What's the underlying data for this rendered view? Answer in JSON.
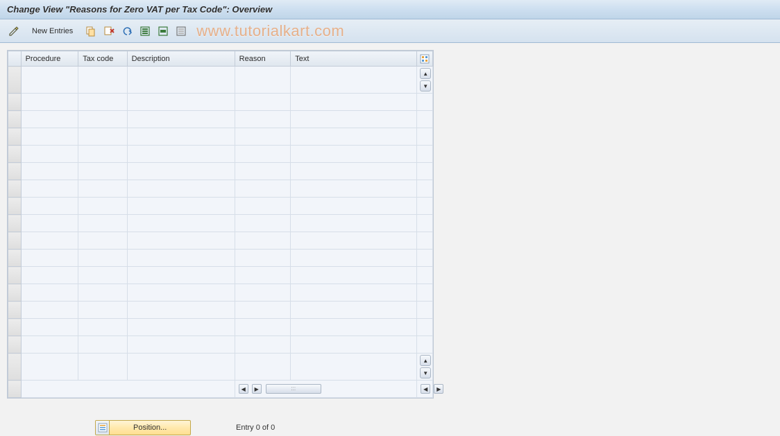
{
  "title": "Change View \"Reasons for Zero VAT per Tax Code\": Overview",
  "toolbar": {
    "new_entries_label": "New Entries",
    "watermark": "www.tutorialkart.com"
  },
  "grid": {
    "columns": [
      "Procedure",
      "Tax code",
      "Description",
      "Reason",
      "Text"
    ],
    "row_count": 17
  },
  "footer": {
    "position_label": "Position...",
    "entry_text": "Entry 0 of 0"
  }
}
